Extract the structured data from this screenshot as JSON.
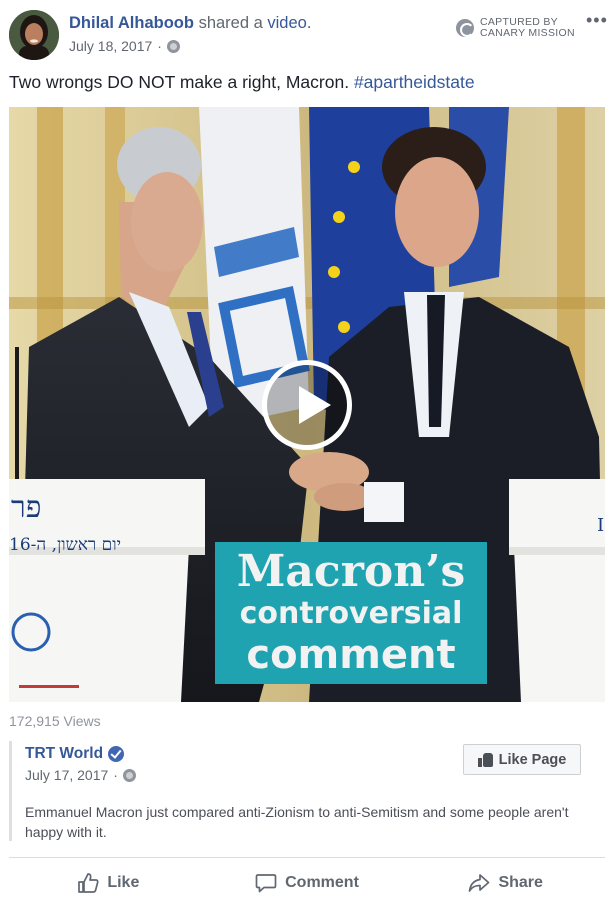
{
  "post": {
    "author": "Dhilal Alhaboob",
    "shared_verb": "shared a",
    "shared_object": "video.",
    "date": "July 18, 2017",
    "date_sep": "·",
    "text_main": "Two wrongs DO NOT make a right, Macron.",
    "hashtag": "#apartheidstate"
  },
  "watermark": {
    "line1": "CAPTURED BY",
    "line2": "CANARY MISSION"
  },
  "video": {
    "caption_line1": "Macron’s",
    "caption_line2": "controversial",
    "caption_line3": "comment",
    "podium_text_1": "פר",
    "podium_text_2": "יום ראשון, ה-16",
    "podium_text_right": "I",
    "views": "172,915 Views"
  },
  "shared_page": {
    "name": "TRT World",
    "date": "July 17, 2017",
    "date_sep": "·",
    "like_page_label": "Like Page",
    "description": "Emmanuel Macron just compared anti-Zionism to anti-Semitism and some people aren't happy with it."
  },
  "actions": {
    "like": "Like",
    "comment": "Comment",
    "share": "Share"
  },
  "icons": {
    "avatar": "profile-photo",
    "globe": "globe-icon",
    "verified": "verified-badge-icon",
    "more": "more-options-icon",
    "play": "play-icon"
  },
  "colors": {
    "link": "#365899",
    "caption_bg": "#1fa3b0",
    "muted": "#616770"
  }
}
